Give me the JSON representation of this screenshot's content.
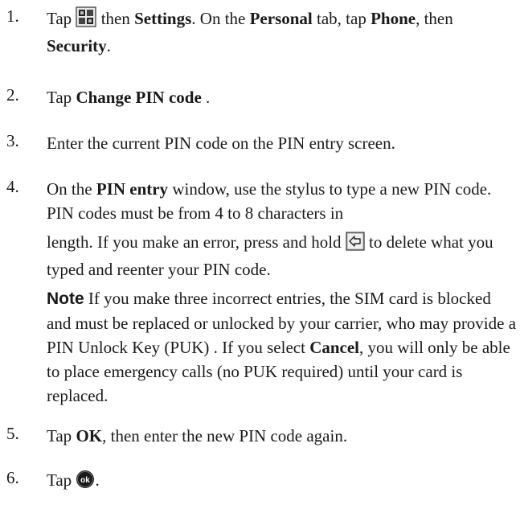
{
  "steps": [
    {
      "number": "1.",
      "tap": "Tap",
      "then": "then",
      "settings": "Settings",
      "on_the": ". On the",
      "personal": "Personal",
      "tab_tap": "tab, tap",
      "phone": "Phone",
      "then2": ", then",
      "security": "Security",
      "end": ".",
      "icon": "start-menu-icon"
    },
    {
      "number": "2.",
      "tap": "Tap",
      "change_pin": "Change PIN code",
      "end": "."
    },
    {
      "number": "3.",
      "text": "Enter the current PIN code on the PIN entry screen."
    },
    {
      "number": "4.",
      "on_the": "On the",
      "pin_entry": "PIN entry",
      "rest1": "window, use the stylus to type a new PIN code. PIN codes must be from 4 to 8 characters in",
      "rest2": "length. If you make an error, press and hold",
      "to": "to",
      "rest3": "delete what you typed and reenter your PIN code.",
      "backspace_icon": "backspace-arrow-icon",
      "note_label": "Note",
      "note_text1": "If you make three incorrect entries, the SIM card is blocked and must be replaced or unlocked by your carrier, who may provide a PIN Unlock Key (PUK) . If you select",
      "cancel": "Cancel",
      "note_text2": ", you will only be able to place emergency calls (no PUK required) until your card is replaced."
    },
    {
      "number": "5.",
      "tap": "Tap",
      "ok": "OK",
      "rest": ", then enter the new PIN code again."
    },
    {
      "number": "6.",
      "tap": "Tap",
      "end": ".",
      "ok_icon": "ok-button-icon"
    }
  ]
}
